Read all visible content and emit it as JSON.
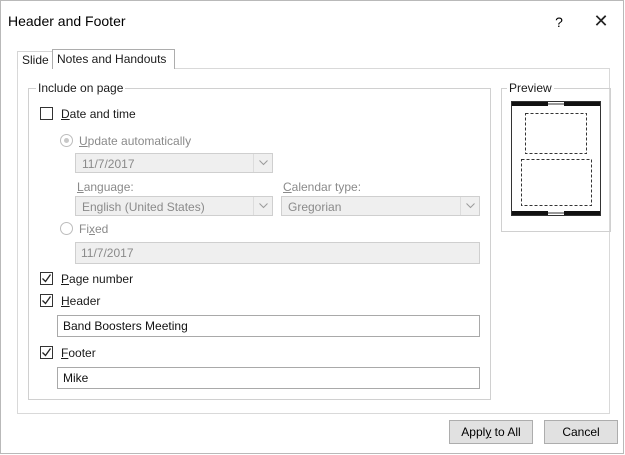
{
  "window": {
    "title": "Header and Footer",
    "help": "?",
    "close": "✕"
  },
  "tabs": [
    {
      "label": "Slide",
      "active": false
    },
    {
      "label": "Notes and Handouts",
      "active": true
    }
  ],
  "include_on_page": {
    "legend": "Include on page",
    "date_and_time": {
      "pre": "",
      "key": "D",
      "post": "ate and time",
      "checked": false
    },
    "update_automatically": {
      "pre": "",
      "key": "U",
      "post": "pdate automatically",
      "selected": true,
      "disabled": true
    },
    "date_combo": {
      "value": "11/7/2017"
    },
    "language": {
      "pre": "",
      "key": "L",
      "post": "anguage:",
      "value": "English (United States)"
    },
    "calendar_type": {
      "pre": "",
      "key": "C",
      "post": "alendar type:",
      "value": "Gregorian"
    },
    "fixed": {
      "pre": "Fi",
      "key": "x",
      "post": "ed",
      "selected": false,
      "disabled": true,
      "value": "11/7/2017"
    },
    "page_number": {
      "pre": "",
      "key": "P",
      "post": "age number",
      "checked": true
    },
    "header": {
      "pre": "",
      "key": "H",
      "post": "eader",
      "checked": true,
      "value": "Band Boosters Meeting"
    },
    "footer": {
      "pre": "",
      "key": "F",
      "post": "ooter",
      "checked": true,
      "value": "Mike"
    }
  },
  "preview": {
    "legend": "Preview"
  },
  "buttons": {
    "apply_all": {
      "pre": "Appl",
      "key": "y",
      "post": " to All"
    },
    "cancel": "Cancel"
  }
}
